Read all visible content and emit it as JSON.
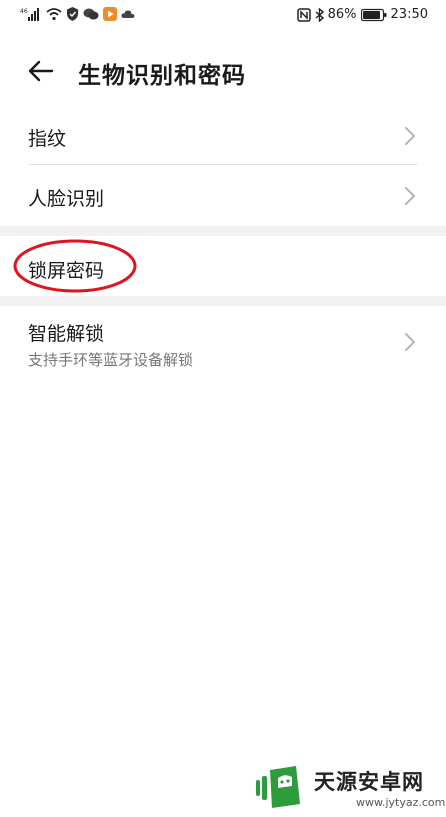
{
  "status_bar": {
    "left_badge": "46",
    "battery": "86%",
    "time": "23:50"
  },
  "header": {
    "title": "生物识别和密码",
    "back_icon": "arrow-left-icon"
  },
  "settings": {
    "fingerprint": {
      "label": "指纹"
    },
    "face": {
      "label": "人脸识别"
    },
    "lock_password": {
      "label": "锁屏密码"
    },
    "smart_unlock": {
      "label": "智能解锁",
      "subtitle": "支持手环等蓝牙设备解锁"
    }
  },
  "annotation": {
    "color": "#e0141e"
  },
  "watermark": {
    "brand": "天源安卓网",
    "url": "www.jytyaz.com",
    "logo_color": "#2e9b3c"
  },
  "colors": {
    "divider": "#e3e3e3",
    "section_gap": "#f1f1f1",
    "chevron": "#b5b5b5"
  }
}
